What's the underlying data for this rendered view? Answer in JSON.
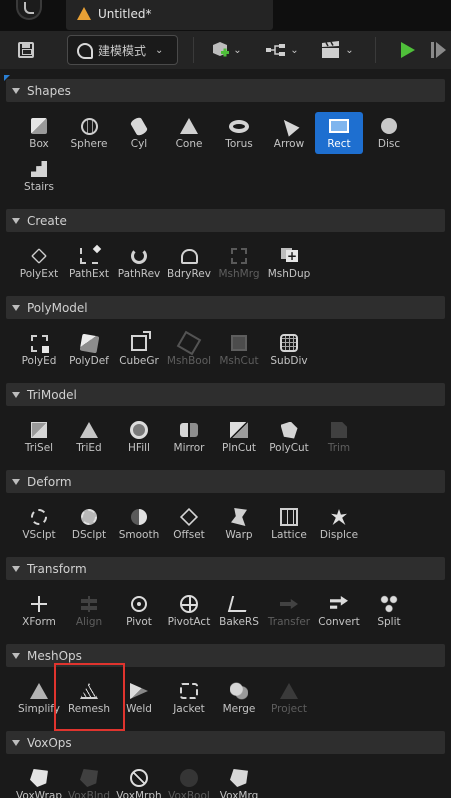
{
  "window": {
    "tab_title": "Untitled*"
  },
  "toolbar": {
    "mode_label": "建模模式"
  },
  "categories": [
    {
      "label": "Shapes",
      "tools": [
        {
          "label": "Box",
          "icon": "cube"
        },
        {
          "label": "Sphere",
          "icon": "sphere"
        },
        {
          "label": "Cyl",
          "icon": "cyl"
        },
        {
          "label": "Cone",
          "icon": "cone"
        },
        {
          "label": "Torus",
          "icon": "torus"
        },
        {
          "label": "Arrow",
          "icon": "arrow"
        },
        {
          "label": "Rect",
          "icon": "rect",
          "selected": true
        },
        {
          "label": "Disc",
          "icon": "disc"
        },
        {
          "label": "Stairs",
          "icon": "stairs"
        }
      ]
    },
    {
      "label": "Create",
      "tools": [
        {
          "label": "PolyExt",
          "icon": "pen"
        },
        {
          "label": "PathExt",
          "icon": "polyline"
        },
        {
          "label": "PathRev",
          "icon": "rev"
        },
        {
          "label": "BdryRev",
          "icon": "bdry"
        },
        {
          "label": "MshMrg",
          "icon": "merge",
          "disabled": true
        },
        {
          "label": "MshDup",
          "icon": "dup"
        }
      ]
    },
    {
      "label": "PolyModel",
      "tools": [
        {
          "label": "PolyEd",
          "icon": "edit"
        },
        {
          "label": "PolyDef",
          "icon": "deform"
        },
        {
          "label": "CubeGr",
          "icon": "cubegr"
        },
        {
          "label": "MshBool",
          "icon": "bool",
          "disabled": true
        },
        {
          "label": "MshCut",
          "icon": "cut",
          "disabled": true
        },
        {
          "label": "SubDiv",
          "icon": "subdiv"
        }
      ]
    },
    {
      "label": "TriModel",
      "tools": [
        {
          "label": "TriSel",
          "icon": "trisel"
        },
        {
          "label": "TriEd",
          "icon": "tried"
        },
        {
          "label": "HFill",
          "icon": "hfill"
        },
        {
          "label": "Mirror",
          "icon": "mirror"
        },
        {
          "label": "PlnCut",
          "icon": "plncut"
        },
        {
          "label": "PolyCut",
          "icon": "polycut"
        },
        {
          "label": "Trim",
          "icon": "trim",
          "disabled": true
        }
      ]
    },
    {
      "label": "Deform",
      "tools": [
        {
          "label": "VSclpt",
          "icon": "vsculpt"
        },
        {
          "label": "DSclpt",
          "icon": "dsculpt"
        },
        {
          "label": "Smooth",
          "icon": "smooth"
        },
        {
          "label": "Offset",
          "icon": "offset"
        },
        {
          "label": "Warp",
          "icon": "warp"
        },
        {
          "label": "Lattice",
          "icon": "lattice"
        },
        {
          "label": "Displce",
          "icon": "displace"
        }
      ]
    },
    {
      "label": "Transform",
      "tools": [
        {
          "label": "XForm",
          "icon": "xform"
        },
        {
          "label": "Align",
          "icon": "align",
          "disabled": true
        },
        {
          "label": "Pivot",
          "icon": "pivot"
        },
        {
          "label": "PivotAct",
          "icon": "pivotact"
        },
        {
          "label": "BakeRS",
          "icon": "bakers"
        },
        {
          "label": "Transfer",
          "icon": "transfer",
          "disabled": true
        },
        {
          "label": "Convert",
          "icon": "convert"
        },
        {
          "label": "Split",
          "icon": "split"
        }
      ]
    },
    {
      "label": "MeshOps",
      "tools": [
        {
          "label": "Simplify",
          "icon": "simplify"
        },
        {
          "label": "Remesh",
          "icon": "remesh"
        },
        {
          "label": "Weld",
          "icon": "weld"
        },
        {
          "label": "Jacket",
          "icon": "jacket"
        },
        {
          "label": "Merge",
          "icon": "mmerge"
        },
        {
          "label": "Project",
          "icon": "project",
          "disabled": true
        }
      ]
    },
    {
      "label": "VoxOps",
      "tools": [
        {
          "label": "VoxWrap",
          "icon": "vwrap"
        },
        {
          "label": "VoxBlnd",
          "icon": "vblend",
          "disabled": true
        },
        {
          "label": "VoxMrph",
          "icon": "vmorph"
        },
        {
          "label": "VoxBool",
          "icon": "vbool",
          "disabled": true
        },
        {
          "label": "VoxMrg",
          "icon": "vmrg"
        }
      ]
    }
  ]
}
